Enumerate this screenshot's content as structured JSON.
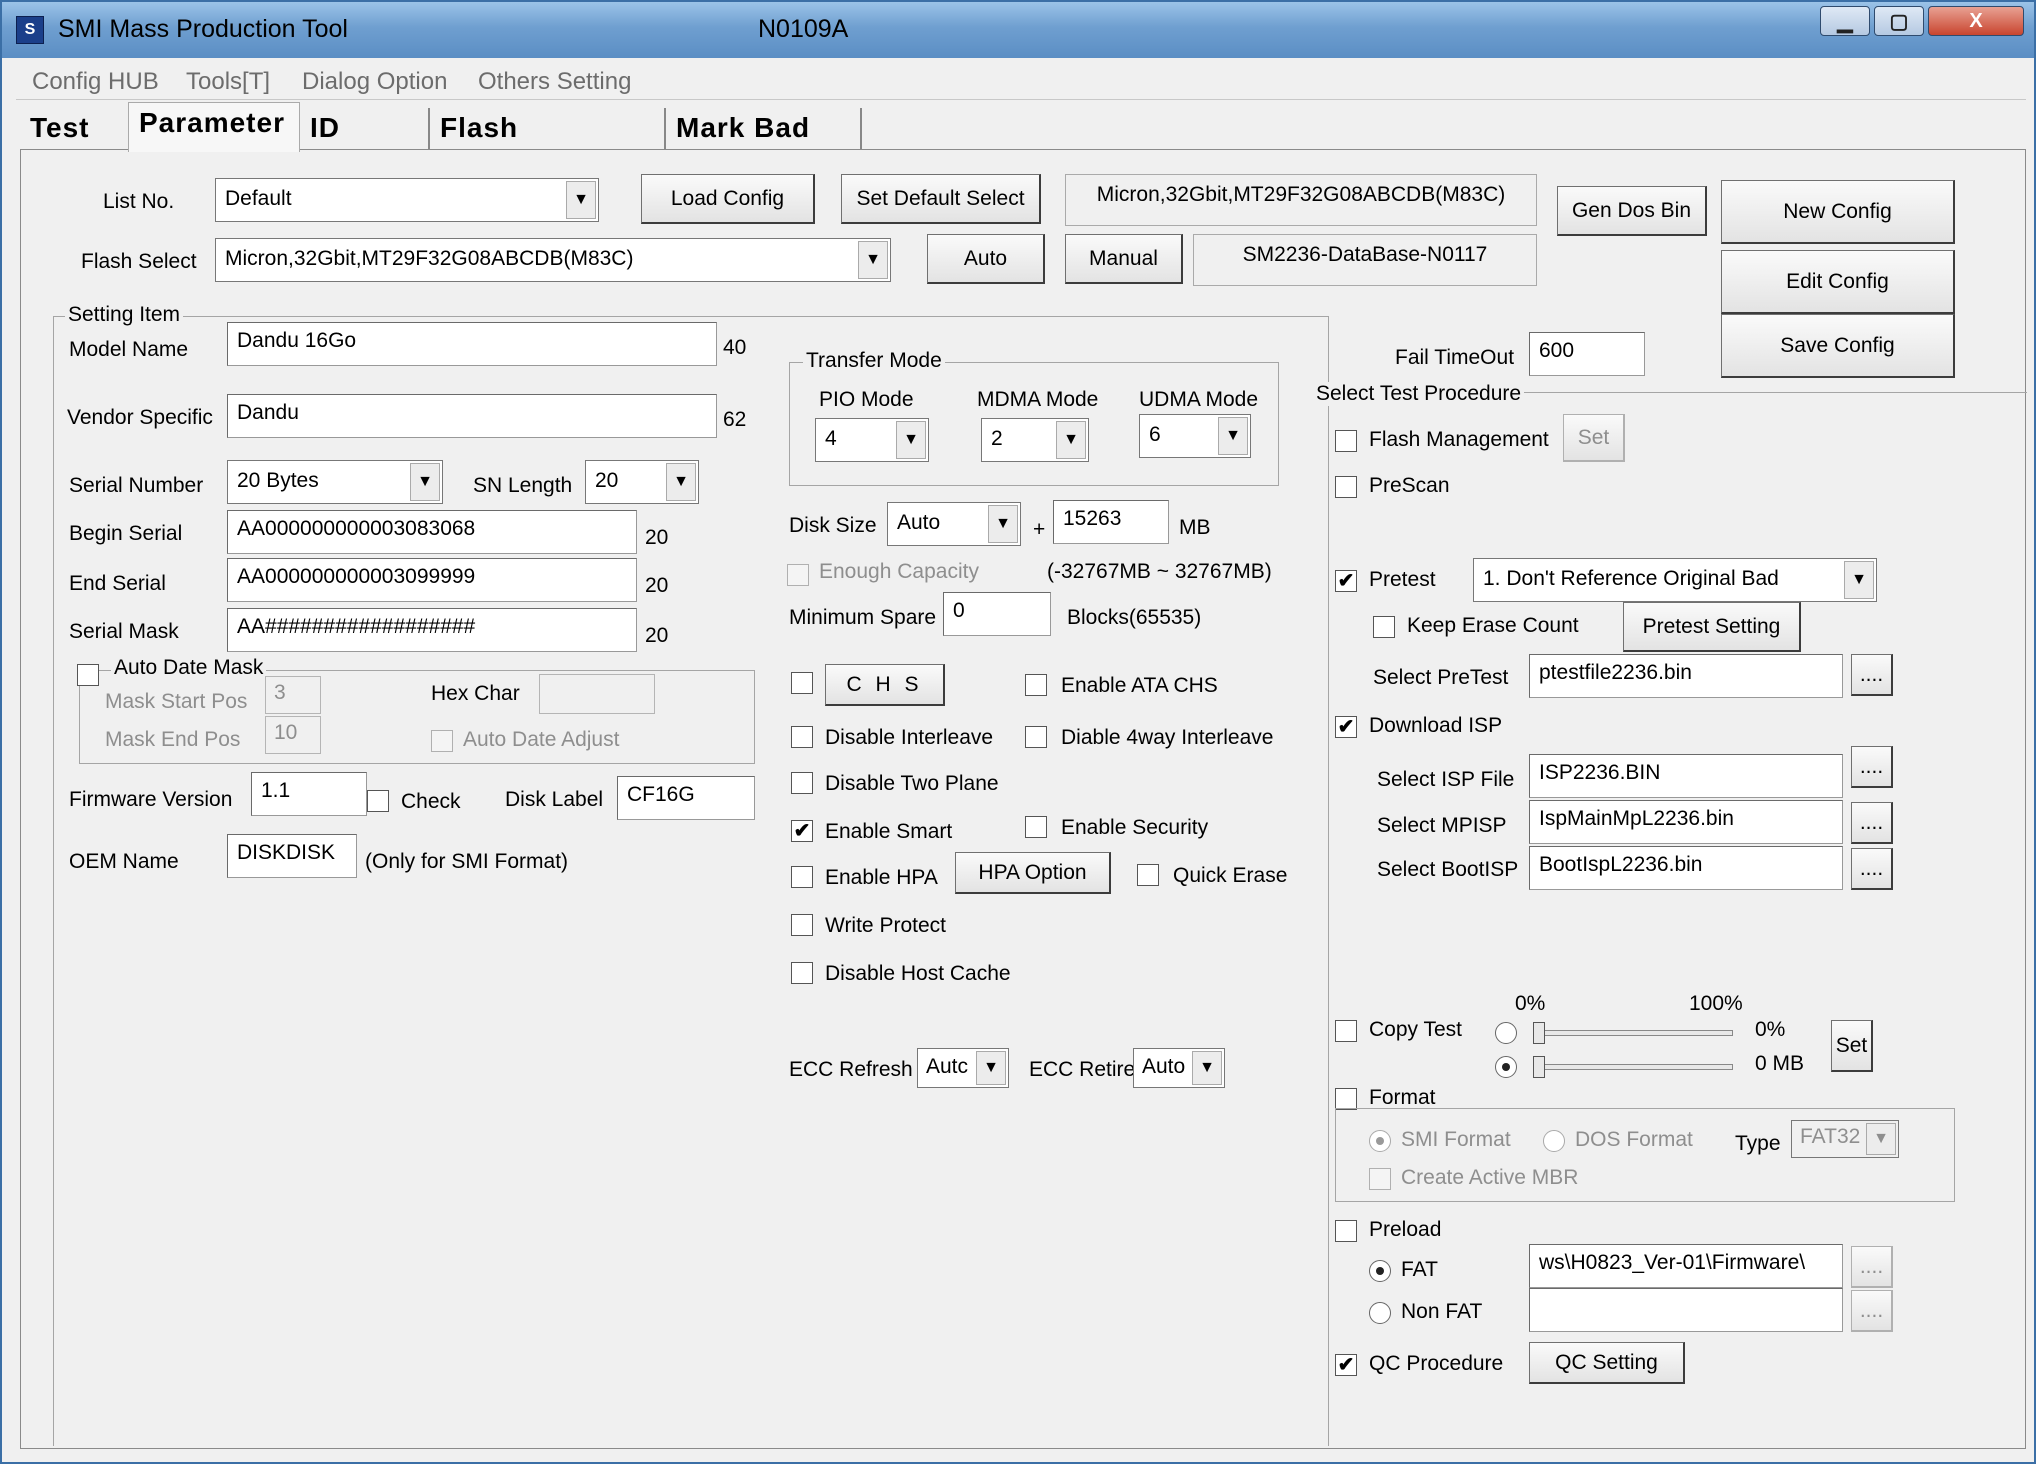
{
  "window": {
    "title": "SMI Mass Production Tool",
    "version": "N0109A",
    "minimize": "▁",
    "maximize": "▢",
    "close": "X"
  },
  "menu": [
    "Config HUB",
    "Tools[T]",
    "Dialog Option",
    "Others Setting"
  ],
  "tabs": [
    "Test",
    "Parameter",
    "ID Table",
    "Flash Diagnosis",
    "Mark Bad Info"
  ],
  "top": {
    "list_no_label": "List No.",
    "list_no_value": "Default",
    "flash_select_label": "Flash Select",
    "flash_select_value": "Micron,32Gbit,MT29F32G08ABCDB(M83C)",
    "load_config": "Load Config",
    "set_default_select": "Set Default Select",
    "flash_info": "Micron,32Gbit,MT29F32G08ABCDB(M83C)",
    "auto": "Auto",
    "manual": "Manual",
    "database": "SM2236-DataBase-N0117",
    "gen_dos_bin": "Gen Dos Bin",
    "new_config": "New Config",
    "edit_config": "Edit Config",
    "save_config": "Save Config"
  },
  "setting": {
    "group_label": "Setting Item",
    "model_name_label": "Model Name",
    "model_name": "Dandu 16Go",
    "model_len": "40",
    "vendor_label": "Vendor Specific",
    "vendor": "Dandu",
    "vendor_len": "62",
    "serial_number_label": "Serial Number",
    "serial_number": "20 Bytes",
    "sn_length_label": "SN Length",
    "sn_length": "20",
    "begin_serial_label": "Begin Serial",
    "begin_serial": "AA000000000003083068",
    "begin_len": "20",
    "end_serial_label": "End Serial",
    "end_serial": "AA000000000003099999",
    "end_len": "20",
    "serial_mask_label": "Serial Mask",
    "serial_mask": "AA##################",
    "mask_len": "20",
    "auto_date_mask": "Auto Date Mask",
    "mask_start_label": "Mask Start Pos",
    "mask_start": "3",
    "hex_char_label": "Hex Char",
    "mask_end_label": "Mask End Pos",
    "mask_end": "10",
    "auto_date_adjust": "Auto Date Adjust",
    "fw_label": "Firmware Version",
    "fw": "1.1",
    "check": "Check",
    "disk_label_label": "Disk Label",
    "disk_label": "CF16G",
    "oem_label": "OEM Name",
    "oem": "DISKDISK",
    "oem_note": "(Only for SMI Format)"
  },
  "transfer": {
    "group_label": "Transfer Mode",
    "pio_label": "PIO Mode",
    "pio": "4",
    "mdma_label": "MDMA Mode",
    "mdma": "2",
    "udma_label": "UDMA Mode",
    "udma": "6"
  },
  "middle": {
    "disk_size_label": "Disk Size",
    "disk_size": "Auto",
    "plus": "+",
    "disk_mb": "15263",
    "mb": "MB",
    "enough_capacity": "Enough Capacity",
    "range": "(-32767MB ~ 32767MB)",
    "min_spare_label": "Minimum Spare",
    "min_spare": "0",
    "blocks": "Blocks(65535)",
    "chs": "C H S",
    "enable_ata_chs": "Enable ATA CHS",
    "disable_interleave": "Disable Interleave",
    "diable_4way": "Diable 4way Interleave",
    "disable_two_plane": "Disable Two Plane",
    "enable_smart": "Enable Smart",
    "enable_security": "Enable Security",
    "enable_hpa": "Enable HPA",
    "hpa_option": "HPA Option",
    "quick_erase": "Quick Erase",
    "write_protect": "Write Protect",
    "disable_host_cache": "Disable Host Cache",
    "ecc_refresh_label": "ECC Refresh",
    "ecc_refresh": "Autc",
    "ecc_retire_label": "ECC Retire",
    "ecc_retire": "Auto"
  },
  "right": {
    "fail_timeout_label": "Fail TimeOut",
    "fail_timeout": "600",
    "procedure_label": "Select Test Procedure",
    "flash_management": "Flash Management",
    "set": "Set",
    "prescan": "PreScan",
    "pretest": "Pretest",
    "pretest_value": "1. Don't Reference Original Bad",
    "keep_erase_count": "Keep Erase Count",
    "pretest_setting": "Pretest Setting",
    "select_pretest_label": "Select PreTest",
    "select_pretest": "ptestfile2236.bin",
    "browse": "....",
    "download_isp": "Download ISP",
    "isp_file_label": "Select ISP File",
    "isp_file": "ISP2236.BIN",
    "mpisp_label": "Select MPISP",
    "mpisp": "IspMainMpL2236.bin",
    "bootisp_label": "Select BootISP",
    "bootisp": "BootIspL2236.bin",
    "pct0": "0%",
    "pct100": "100%",
    "copy_test": "Copy Test",
    "copy_pct": "0%",
    "copy_mb": "0 MB",
    "copy_set": "Set",
    "format": "Format",
    "smi_format": "SMI Format",
    "dos_format": "DOS Format",
    "type_label": "Type",
    "type": "FAT32",
    "create_mbr": "Create Active MBR",
    "preload": "Preload",
    "fat": "FAT",
    "fat_path": "ws\\H0823_Ver-01\\Firmware\\",
    "non_fat": "Non FAT",
    "qc_procedure": "QC Procedure",
    "qc_setting": "QC Setting"
  },
  "checks": {
    "pretest": "✔",
    "download_isp": "✔",
    "enable_smart": "✔",
    "qc_procedure": "✔"
  },
  "colors": {
    "title_bar": "#6f9fd0",
    "close": "#c9452f"
  }
}
